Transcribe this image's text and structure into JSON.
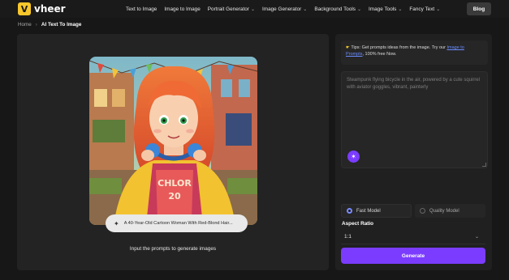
{
  "brand": {
    "logo_letter": "V",
    "name": "vheer",
    "accent": "#f7c72b"
  },
  "nav": {
    "items": [
      {
        "label": "Text to Image",
        "dropdown": false
      },
      {
        "label": "Image to Image",
        "dropdown": false
      },
      {
        "label": "Portrait Generator",
        "dropdown": true
      },
      {
        "label": "Image Generator",
        "dropdown": true
      },
      {
        "label": "Background Tools",
        "dropdown": true
      },
      {
        "label": "Image Tools",
        "dropdown": true
      },
      {
        "label": "Fancy Text",
        "dropdown": true
      }
    ],
    "blog_label": "Blog"
  },
  "breadcrumb": {
    "home": "Home",
    "current": "AI Text To Image"
  },
  "preview": {
    "prompt_chip": "A 40-Year-Old Cartoon Woman With Red-Blond Hair...",
    "caption": "Input the prompts to generate images",
    "shirt_text_1": "CHLOR",
    "shirt_text_2": "20"
  },
  "tips": {
    "text": "Tips: Get prompts ideas from the image. Try our",
    "link": "Image to Prompts",
    "suffix": ", 100% free Now."
  },
  "prompt": {
    "placeholder": "Steampunk flying bicycle in the air, powered by a cute squirrel with aviator goggles, vibrant, painterly"
  },
  "models": {
    "fast_label": "Fast Model",
    "quality_label": "Quality Model",
    "selected": "fast"
  },
  "aspect": {
    "label": "Aspect Ratio",
    "value": "1:1"
  },
  "generate_label": "Generate",
  "colors": {
    "accent_purple": "#7b3cff",
    "panel": "#232323",
    "background": "#171717"
  }
}
